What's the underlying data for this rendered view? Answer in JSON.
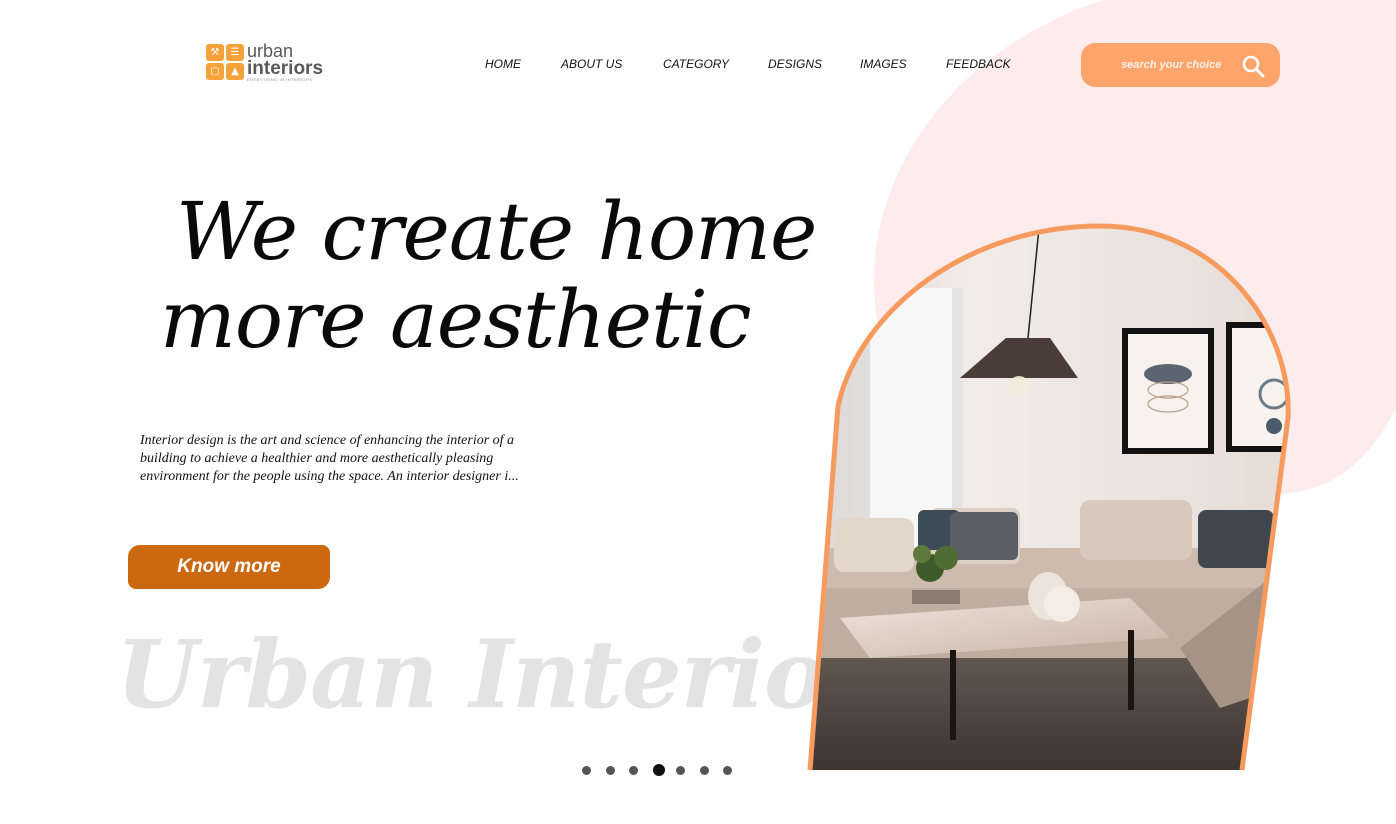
{
  "brand": {
    "name_line1": "urban",
    "name_line2": "interiors",
    "tagline": "EVERYTHING IN INTERIORS",
    "icon": "house-tools-icon",
    "color": "#f5a23a"
  },
  "nav": {
    "items": [
      {
        "label": "HOME"
      },
      {
        "label": "ABOUT US"
      },
      {
        "label": "CATEGORY"
      },
      {
        "label": "DESIGNS"
      },
      {
        "label": "IMAGES"
      },
      {
        "label": "FEEDBACK"
      }
    ]
  },
  "search": {
    "placeholder": "search your choice",
    "value": "",
    "icon": "search-icon",
    "color": "#ffa46a"
  },
  "hero": {
    "headline_line1": "We create home",
    "headline_line2": "more aesthetic",
    "description": "Interior design is the art and science of enhancing the interior of a building to achieve a healthier and more aesthetically pleasing environment for the people using the space. An interior designer i...",
    "cta_label": "Know more",
    "cta_color": "#cc6810",
    "watermark": "Urban Interior",
    "image": "living-room-photo",
    "image_border_color": "#f79a5e",
    "blob_color": "#fdeceb"
  },
  "carousel": {
    "total": 7,
    "active_index": 4
  }
}
